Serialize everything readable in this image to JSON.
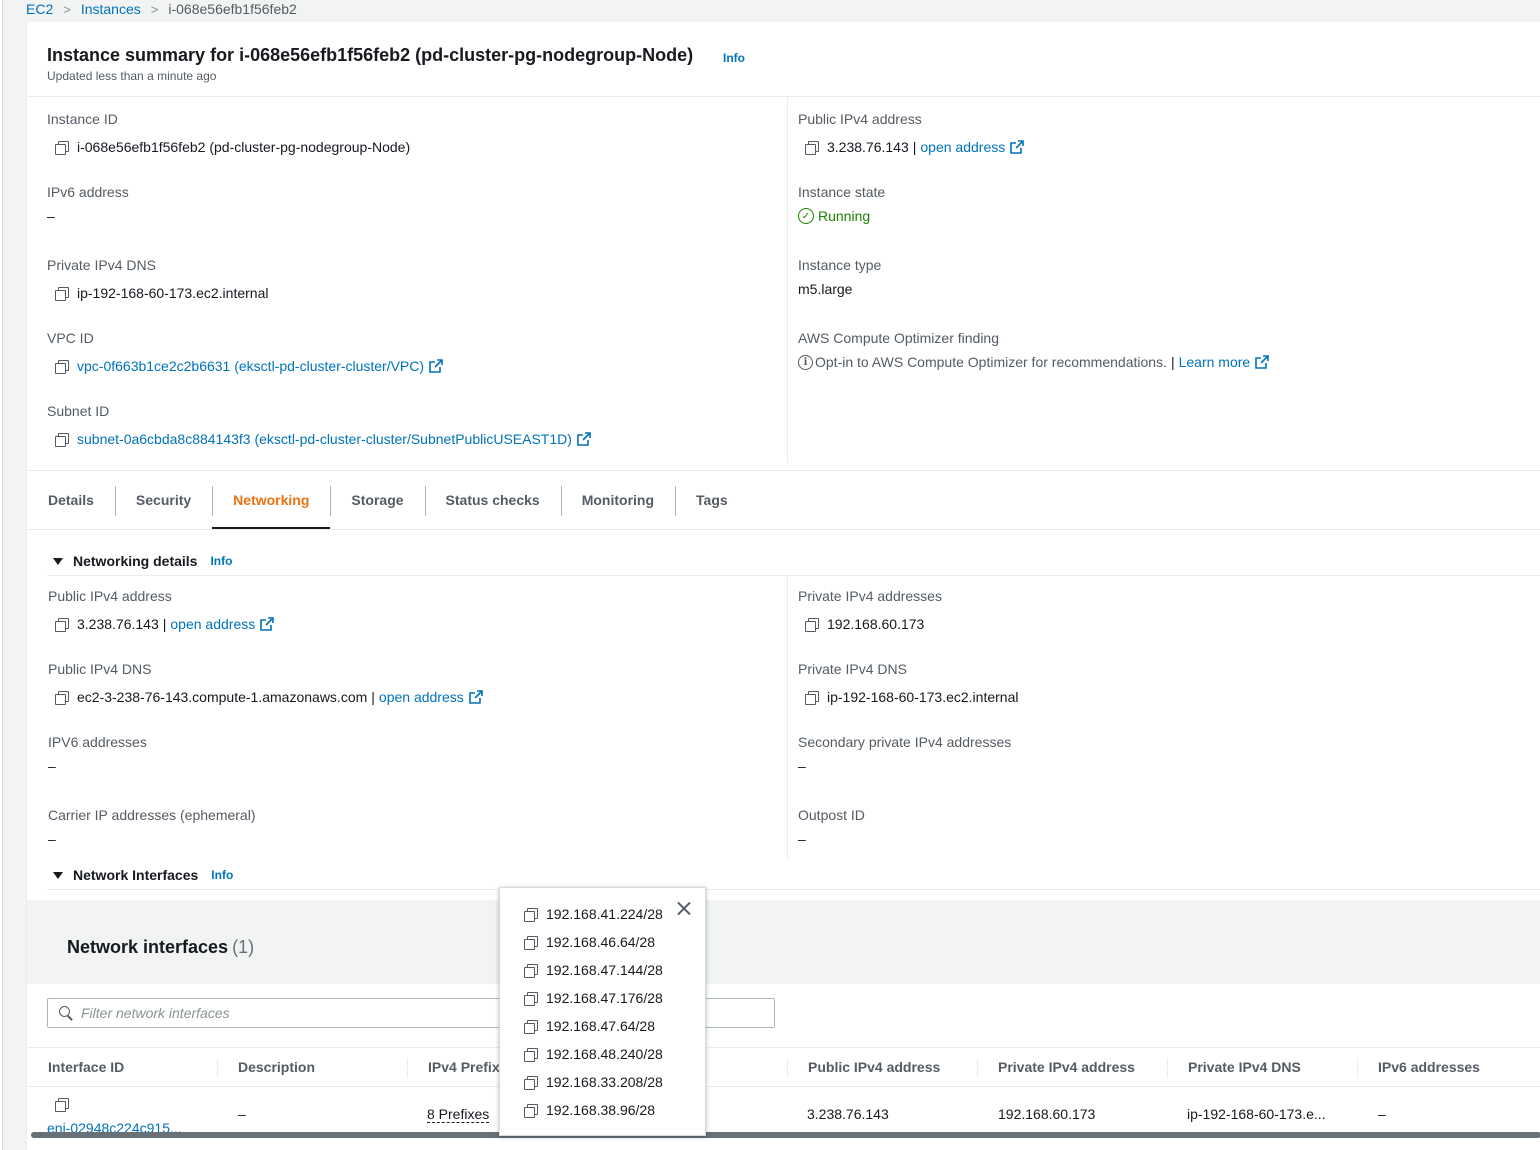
{
  "breadcrumb": {
    "items": [
      "EC2",
      "Instances"
    ],
    "current": "i-068e56efb1f56feb2"
  },
  "summary": {
    "title": "Instance summary for i-068e56efb1f56feb2 (pd-cluster-pg-nodegroup-Node)",
    "info": "Info",
    "updated": "Updated less than a minute ago"
  },
  "details_left": {
    "instance_id_label": "Instance ID",
    "instance_id": "i-068e56efb1f56feb2 (pd-cluster-pg-nodegroup-Node)",
    "ipv6_label": "IPv6 address",
    "ipv6": "–",
    "private_dns_label": "Private IPv4 DNS",
    "private_dns": "ip-192-168-60-173.ec2.internal",
    "vpc_label": "VPC ID",
    "vpc": "vpc-0f663b1ce2c2b6631 (eksctl-pd-cluster-cluster/VPC)",
    "subnet_label": "Subnet ID",
    "subnet": "subnet-0a6cbda8c884143f3 (eksctl-pd-cluster-cluster/SubnetPublicUSEAST1D)"
  },
  "details_right": {
    "public_ip_label": "Public IPv4 address",
    "public_ip": "3.238.76.143",
    "open_address": "open address",
    "state_label": "Instance state",
    "state": "Running",
    "type_label": "Instance type",
    "type": "m5.large",
    "optimizer_label": "AWS Compute Optimizer finding",
    "optimizer_text": "Opt-in to AWS Compute Optimizer for recommendations.",
    "learn_more": "Learn more"
  },
  "tabs": [
    "Details",
    "Security",
    "Networking",
    "Storage",
    "Status checks",
    "Monitoring",
    "Tags"
  ],
  "active_tab": "Networking",
  "networking": {
    "section_title": "Networking details",
    "info": "Info",
    "public_ip_label": "Public IPv4 address",
    "public_ip": "3.238.76.143",
    "open_address": "open address",
    "public_dns_label": "Public IPv4 DNS",
    "public_dns": "ec2-3-238-76-143.compute-1.amazonaws.com",
    "ipv6_label": "IPV6 addresses",
    "ipv6": "–",
    "carrier_label": "Carrier IP addresses (ephemeral)",
    "carrier": "–",
    "private_ips_label": "Private IPv4 addresses",
    "private_ips": "192.168.60.173",
    "private_dns_label": "Private IPv4 DNS",
    "private_dns": "ip-192-168-60-173.ec2.internal",
    "secondary_label": "Secondary private IPv4 addresses",
    "secondary": "–",
    "outpost_label": "Outpost ID",
    "outpost": "–"
  },
  "network_interfaces": {
    "section_title": "Network Interfaces",
    "info": "Info",
    "table_title": "Network interfaces",
    "count": "(1)",
    "filter_placeholder": "Filter network interfaces",
    "columns": [
      "Interface ID",
      "Description",
      "IPv4 Prefixes",
      "Public IPv4 address",
      "Private IPv4 address",
      "Private IPv4 DNS",
      "IPv6 addresses"
    ],
    "row": {
      "interface_id": "eni-02948c224c915...",
      "description": "–",
      "prefixes": "8 Prefixes",
      "public_ip": "3.238.76.143",
      "private_ip": "192.168.60.173",
      "private_dns": "ip-192-168-60-173.e...",
      "ipv6": "–"
    }
  },
  "prefix_popover": {
    "items": [
      "192.168.41.224/28",
      "192.168.46.64/28",
      "192.168.47.144/28",
      "192.168.47.176/28",
      "192.168.47.64/28",
      "192.168.48.240/28",
      "192.168.33.208/28",
      "192.168.38.96/28"
    ]
  },
  "colors": {
    "link": "#0073bb",
    "active_tab": "#ec7211",
    "running": "#1d8102"
  }
}
